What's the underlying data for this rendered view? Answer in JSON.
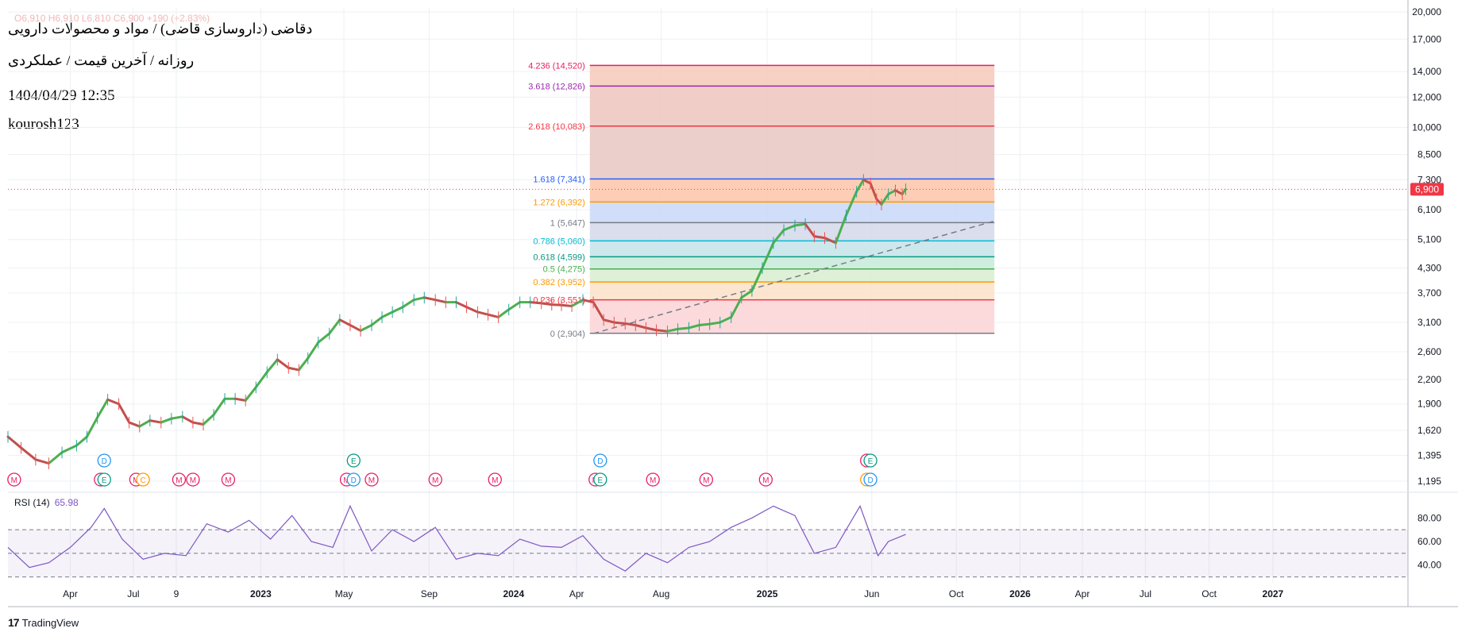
{
  "header": {
    "symbol_line": "دقاضی (داروسازی قاضی) / مواد و محصولات دارویی",
    "timeframe_line": "روزانه / آخرین قیمت / عملکردی",
    "datetime": "1404/04/29 12:35",
    "author": "kourosh123",
    "ohlc_faint": "O6,910  H6,910  L6,810  C6,900  +190 (+2.83%)"
  },
  "branding": {
    "logo_text": "TradingView",
    "logo_icon": "tradingview-logo-icon"
  },
  "colors": {
    "up": "#26a69a",
    "down": "#ef5350",
    "price_badge": "#f23645",
    "trend_green": "#4caf50",
    "trend_red": "#c0504d",
    "rsi": "#7e57c2",
    "grid": "#eef0f3",
    "axis_text": "#131722"
  },
  "chart_data": [
    {
      "type": "line",
      "name": "price",
      "scale": "log",
      "last_price": 6900,
      "ylim": [
        1150,
        20500
      ],
      "y_ticks": [
        20000,
        17000,
        14000,
        12000,
        10000,
        8500,
        7300,
        6100,
        5100,
        4300,
        3700,
        3100,
        2600,
        2200,
        1900,
        1620,
        1395,
        1195
      ],
      "y_tick_labels": [
        "20,000",
        "17,000",
        "14,000",
        "12,000",
        "10,000",
        "8,500",
        "7,300",
        "6,100",
        "5,100",
        "4,300",
        "3,700",
        "3,100",
        "2,600",
        "2,200",
        "1,900",
        "1,620",
        "1,395",
        "1,195"
      ],
      "last_price_label": "6,900",
      "x_labels": [
        "Apr",
        "Jul",
        "9",
        "2023",
        "May",
        "Sep",
        "2024",
        "Apr",
        "Aug",
        "2025",
        "Jun",
        "Oct",
        "2026",
        "Apr",
        "Jul",
        "Oct",
        "2027"
      ],
      "x_label_bold": [
        false,
        false,
        false,
        true,
        false,
        false,
        true,
        false,
        false,
        true,
        false,
        false,
        true,
        false,
        false,
        false,
        true
      ],
      "x_label_dates": [
        "2022-04-01",
        "2022-07-01",
        "2022-09-01",
        "2023-01-01",
        "2023-05-01",
        "2023-09-01",
        "2024-01-01",
        "2024-04-01",
        "2024-08-01",
        "2025-01-01",
        "2025-06-01",
        "2025-10-01",
        "2026-01-01",
        "2026-04-01",
        "2026-07-01",
        "2026-10-01",
        "2027-01-01"
      ],
      "x_range": [
        "2022-01-01",
        "2027-07-15"
      ],
      "series": [
        {
          "x": [
            "2022-01-01",
            "2022-01-20",
            "2022-02-10",
            "2022-03-01",
            "2022-03-20",
            "2022-04-10",
            "2022-04-25",
            "2022-05-10",
            "2022-05-25",
            "2022-06-10",
            "2022-06-25",
            "2022-07-10",
            "2022-07-25",
            "2022-08-10",
            "2022-08-25",
            "2022-09-10",
            "2022-09-25",
            "2022-10-10",
            "2022-10-25",
            "2022-11-10",
            "2022-11-25",
            "2022-12-10",
            "2022-12-25",
            "2023-01-10",
            "2023-01-25",
            "2023-02-10",
            "2023-02-25",
            "2023-03-10",
            "2023-03-25",
            "2023-04-10",
            "2023-04-25",
            "2023-05-10",
            "2023-05-25",
            "2023-06-10",
            "2023-06-25",
            "2023-07-10",
            "2023-07-25",
            "2023-08-10",
            "2023-08-25",
            "2023-09-10",
            "2023-09-25",
            "2023-10-10",
            "2023-10-25",
            "2023-11-10",
            "2023-11-25",
            "2023-12-10",
            "2023-12-25",
            "2024-01-10",
            "2024-01-25",
            "2024-02-10",
            "2024-02-25",
            "2024-03-10",
            "2024-03-25",
            "2024-04-10",
            "2024-04-25",
            "2024-05-10",
            "2024-05-25",
            "2024-06-10",
            "2024-06-25",
            "2024-07-10",
            "2024-07-25",
            "2024-08-10",
            "2024-08-25",
            "2024-09-10",
            "2024-09-25",
            "2024-10-10",
            "2024-10-25",
            "2024-11-10",
            "2024-11-25",
            "2024-12-10",
            "2024-12-25",
            "2025-01-10",
            "2025-01-25",
            "2025-02-10",
            "2025-02-25",
            "2025-03-10",
            "2025-03-25",
            "2025-04-10",
            "2025-04-25",
            "2025-05-10",
            "2025-05-20",
            "2025-05-30",
            "2025-06-08",
            "2025-06-15",
            "2025-06-25",
            "2025-07-05",
            "2025-07-15",
            "2025-07-20"
          ],
          "values": [
            1560,
            1460,
            1360,
            1330,
            1420,
            1480,
            1560,
            1750,
            1950,
            1900,
            1700,
            1660,
            1720,
            1700,
            1740,
            1760,
            1700,
            1680,
            1780,
            1960,
            1960,
            1940,
            2100,
            2300,
            2480,
            2360,
            2330,
            2500,
            2750,
            2900,
            3150,
            3050,
            2950,
            3050,
            3200,
            3300,
            3400,
            3550,
            3600,
            3550,
            3500,
            3500,
            3400,
            3300,
            3250,
            3200,
            3350,
            3500,
            3500,
            3480,
            3450,
            3440,
            3420,
            3550,
            3500,
            3150,
            3100,
            3080,
            3050,
            3000,
            2960,
            2940,
            2980,
            3000,
            3050,
            3070,
            3100,
            3200,
            3600,
            3750,
            4300,
            5000,
            5400,
            5550,
            5600,
            5200,
            5150,
            5000,
            5900,
            6800,
            7300,
            7150,
            6500,
            6300,
            6700,
            6850,
            6700,
            6900
          ]
        }
      ],
      "fib": {
        "x_start": "2024-04-20",
        "x_end": "2025-11-25",
        "levels": [
          {
            "ratio": "4.236",
            "value": 14520,
            "label": "4.236 (14,520)",
            "color": "#e91e63",
            "fill": "#f6c9b8"
          },
          {
            "ratio": "3.618",
            "value": 12826,
            "label": "3.618 (12,826)",
            "color": "#9c27b0",
            "fill": "#edc6bd"
          },
          {
            "ratio": "2.618",
            "value": 10083,
            "label": "2.618 (10,083)",
            "color": "#f23645",
            "fill": "#e8c7c2"
          },
          {
            "ratio": "1.618",
            "value": 7341,
            "label": "1.618 (7,341)",
            "color": "#2962ff",
            "fill": "#fdc6a8"
          },
          {
            "ratio": "1.272",
            "value": 6392,
            "label": "1.272 (6,392)",
            "color": "#ff9800",
            "fill": "#c8d8f8"
          },
          {
            "ratio": "1",
            "value": 5647,
            "label": "1 (5,647)",
            "color": "#787b86",
            "fill": "#d3d8ea"
          },
          {
            "ratio": "0.786",
            "value": 5060,
            "label": "0.786 (5,060)",
            "color": "#00bcd4",
            "fill": "#c4e4ea"
          },
          {
            "ratio": "0.618",
            "value": 4599,
            "label": "0.618 (4,599)",
            "color": "#089981",
            "fill": "#c6ead9"
          },
          {
            "ratio": "0.5",
            "value": 4275,
            "label": "0.5 (4,275)",
            "color": "#4caf50",
            "fill": "#d8eed0"
          },
          {
            "ratio": "0.382",
            "value": 3952,
            "label": "0.382 (3,952)",
            "color": "#ff9800",
            "fill": "#fbe2c8"
          },
          {
            "ratio": "0.236",
            "value": 3551,
            "label": "0.236 (3,551)",
            "color": "#f23645",
            "fill": "#fbd4d6"
          },
          {
            "ratio": "0",
            "value": 2904,
            "label": "0 (2,904)",
            "color": "#787b86",
            "fill": null
          }
        ]
      },
      "trendline": {
        "x": [
          "2024-04-25",
          "2025-11-25"
        ],
        "values": [
          2900,
          5700
        ]
      },
      "events": [
        {
          "letter": "M",
          "x": "2022-01-10",
          "row": 1
        },
        {
          "letter": "D",
          "x": "2022-05-20",
          "row": 0
        },
        {
          "letter": "M",
          "x": "2022-05-15",
          "row": 1
        },
        {
          "letter": "E",
          "x": "2022-05-20",
          "row": 1
        },
        {
          "letter": "M",
          "x": "2022-07-05",
          "row": 1
        },
        {
          "letter": "C",
          "x": "2022-07-15",
          "row": 1
        },
        {
          "letter": "M",
          "x": "2022-09-05",
          "row": 1
        },
        {
          "letter": "M",
          "x": "2022-09-25",
          "row": 1
        },
        {
          "letter": "M",
          "x": "2022-11-15",
          "row": 1
        },
        {
          "letter": "E",
          "x": "2023-05-15",
          "row": 0
        },
        {
          "letter": "M",
          "x": "2023-05-05",
          "row": 1
        },
        {
          "letter": "D",
          "x": "2023-05-15",
          "row": 1
        },
        {
          "letter": "M",
          "x": "2023-06-10",
          "row": 1
        },
        {
          "letter": "M",
          "x": "2023-09-10",
          "row": 1
        },
        {
          "letter": "M",
          "x": "2023-12-05",
          "row": 1
        },
        {
          "letter": "D",
          "x": "2024-05-05",
          "row": 0
        },
        {
          "letter": "M",
          "x": "2024-04-28",
          "row": 1
        },
        {
          "letter": "E",
          "x": "2024-05-05",
          "row": 1
        },
        {
          "letter": "M",
          "x": "2024-07-20",
          "row": 1
        },
        {
          "letter": "M",
          "x": "2024-10-05",
          "row": 1
        },
        {
          "letter": "M",
          "x": "2024-12-30",
          "row": 1
        },
        {
          "letter": "M",
          "x": "2025-05-25",
          "row": 0
        },
        {
          "letter": "E",
          "x": "2025-05-30",
          "row": 0
        },
        {
          "letter": "C",
          "x": "2025-05-25",
          "row": 1
        },
        {
          "letter": "D",
          "x": "2025-05-30",
          "row": 1
        }
      ]
    },
    {
      "type": "line",
      "name": "rsi",
      "legend_title": "RSI (14)",
      "legend_value": "65.98",
      "ylim": [
        25,
        95
      ],
      "y_ticks": [
        80,
        60,
        40
      ],
      "y_tick_labels": [
        "80.00",
        "60.00",
        "40.00"
      ],
      "band": [
        30,
        70
      ],
      "midline": 50,
      "series": [
        {
          "x": [
            "2022-01-01",
            "2022-02-01",
            "2022-03-01",
            "2022-04-01",
            "2022-05-01",
            "2022-05-20",
            "2022-06-15",
            "2022-07-15",
            "2022-08-15",
            "2022-09-15",
            "2022-10-15",
            "2022-11-15",
            "2022-12-15",
            "2023-01-15",
            "2023-02-15",
            "2023-03-15",
            "2023-04-15",
            "2023-05-10",
            "2023-06-10",
            "2023-07-10",
            "2023-08-10",
            "2023-09-10",
            "2023-10-10",
            "2023-11-10",
            "2023-12-10",
            "2024-01-10",
            "2024-02-10",
            "2024-03-10",
            "2024-04-10",
            "2024-05-10",
            "2024-06-10",
            "2024-07-10",
            "2024-08-10",
            "2024-09-10",
            "2024-10-10",
            "2024-11-10",
            "2024-12-10",
            "2025-01-10",
            "2025-02-10",
            "2025-03-10",
            "2025-04-10",
            "2025-05-15",
            "2025-06-10",
            "2025-06-25",
            "2025-07-20"
          ],
          "values": [
            55,
            38,
            42,
            55,
            72,
            88,
            62,
            45,
            50,
            48,
            75,
            68,
            78,
            62,
            82,
            60,
            55,
            90,
            52,
            70,
            60,
            72,
            45,
            50,
            48,
            62,
            56,
            55,
            65,
            45,
            35,
            50,
            42,
            55,
            60,
            72,
            80,
            90,
            82,
            50,
            55,
            90,
            48,
            60,
            66
          ]
        }
      ]
    }
  ]
}
